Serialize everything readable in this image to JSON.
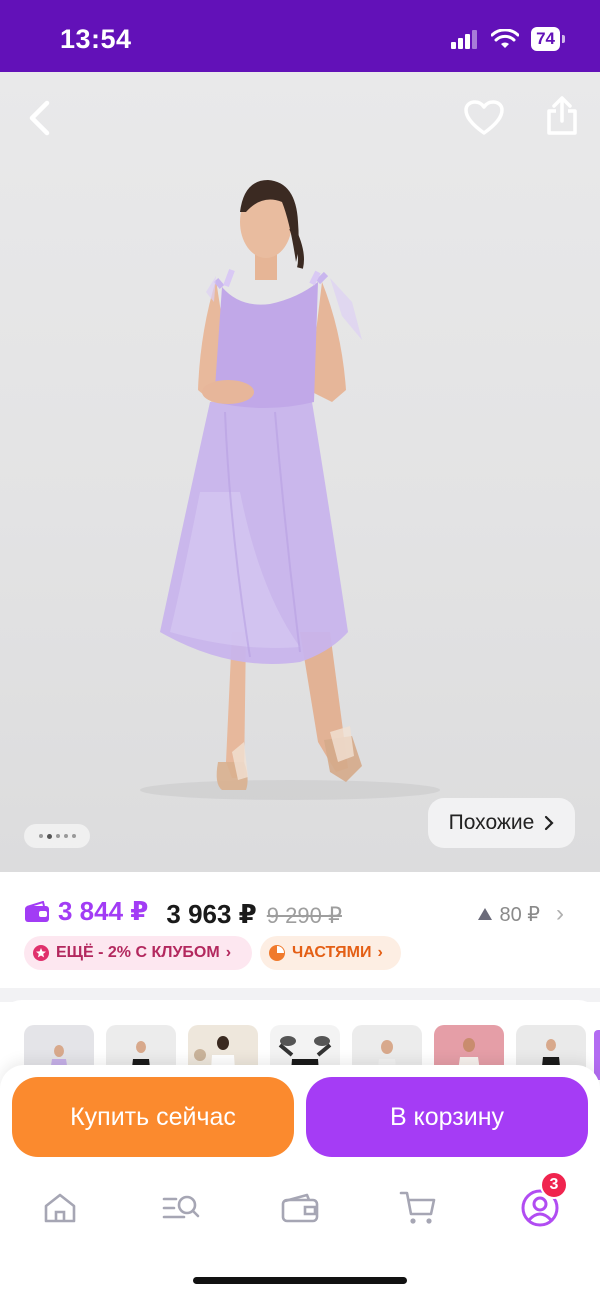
{
  "status_bar": {
    "time": "13:54",
    "battery": "74"
  },
  "product": {
    "image_alt": "Lilac tulle midi dress",
    "photo_index": 1,
    "photo_count": 4,
    "similar_label": "Похожие"
  },
  "prices": {
    "wallet_price": "3 844 ₽",
    "price": "3 963 ₽",
    "old_price": "9 290 ₽",
    "points": "80 ₽"
  },
  "chips": {
    "club": "ЕЩЁ - 2% С КЛУБОМ",
    "installments": "ЧАСТЯМИ"
  },
  "actions": {
    "buy_now": "Купить сейчас",
    "add_to_cart": "В корзину"
  },
  "tabbar": {
    "items": [
      "home",
      "catalog",
      "wallet",
      "cart",
      "profile"
    ],
    "profile_badge": "3"
  },
  "colors": {
    "brand_purple": "#6211b8",
    "cart_button": "#a53cf5",
    "buy_button": "#fb8a2e",
    "wallet_price": "#a23cf5",
    "badge": "#f0244e"
  }
}
